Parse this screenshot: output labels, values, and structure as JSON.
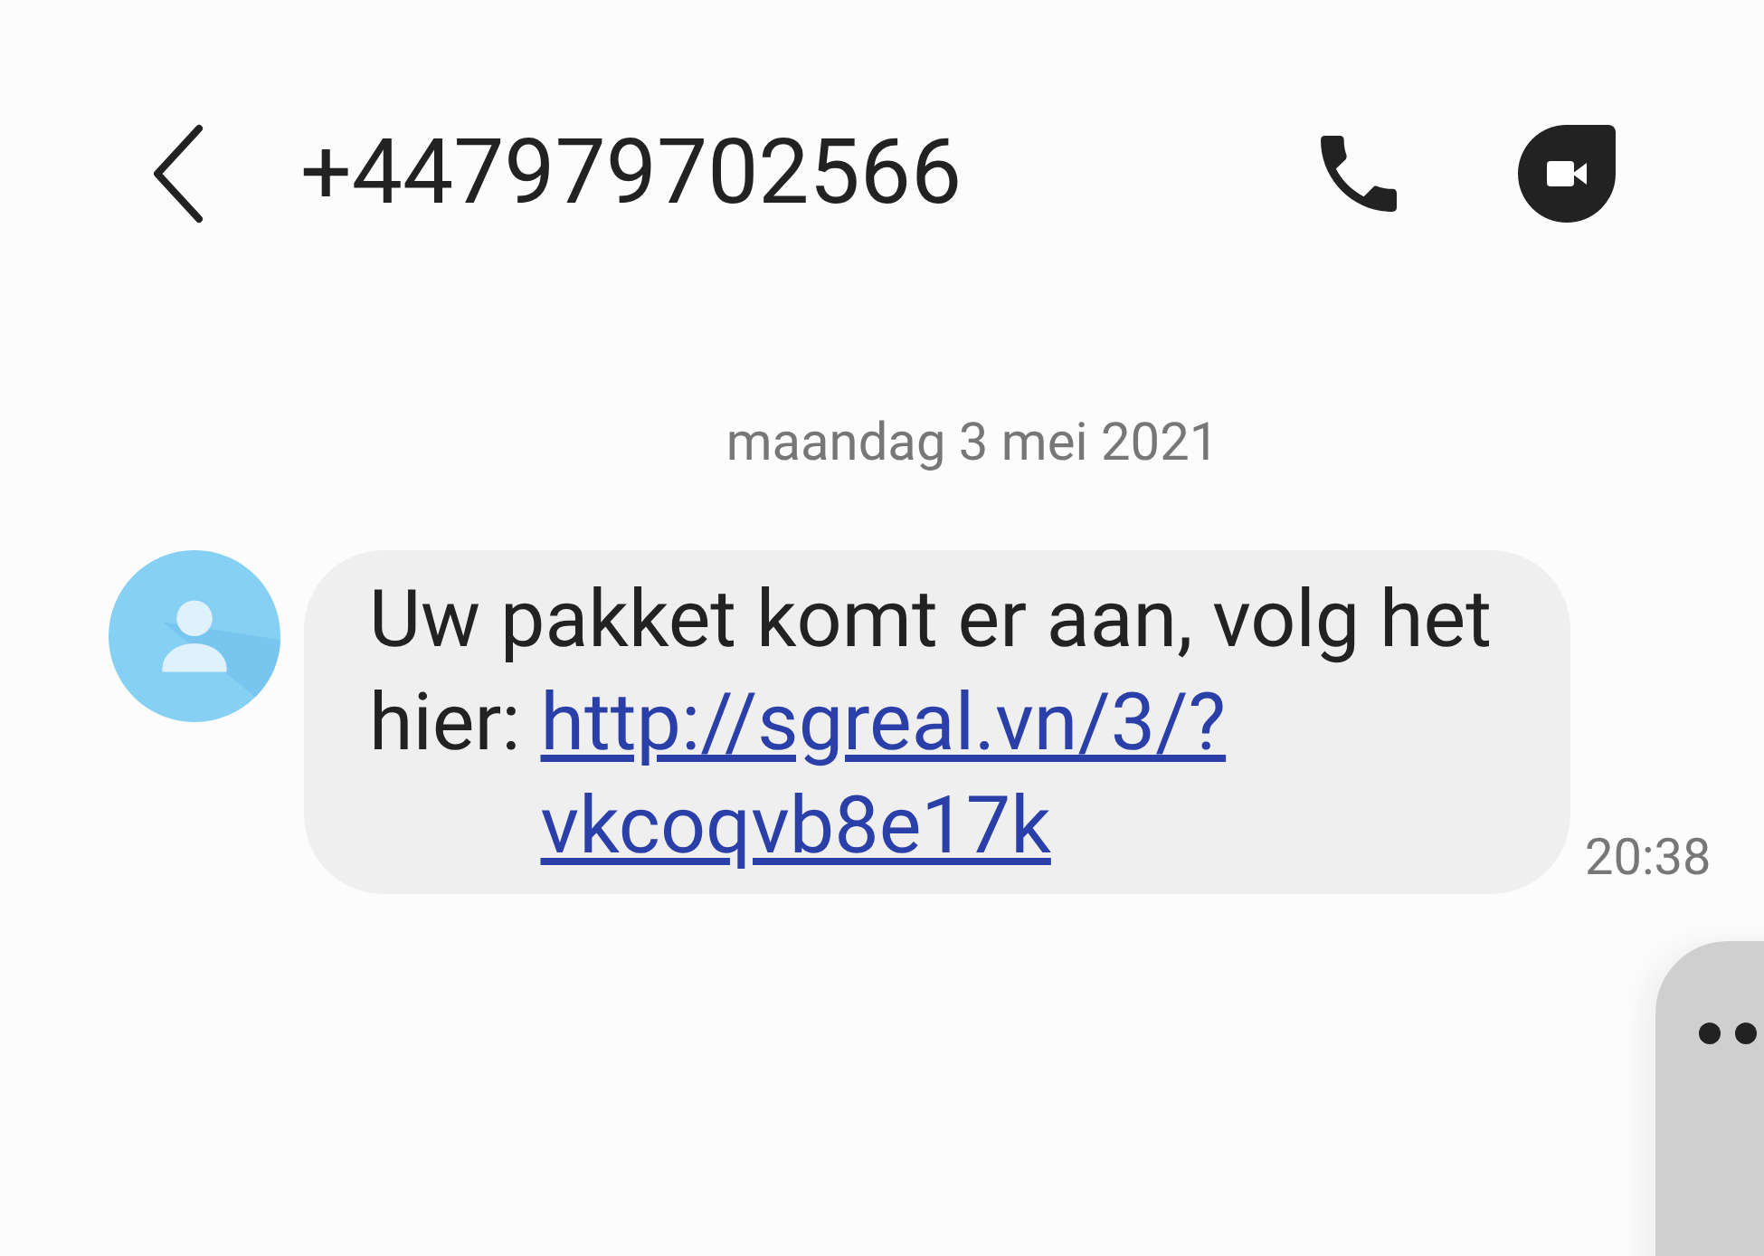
{
  "header": {
    "title": "+447979702566"
  },
  "date_divider": "maandag 3 mei 2021",
  "messages": [
    {
      "kind": "received",
      "text": "Uw pakket komt er aan, volg het hier: ",
      "link": "http://sgreal.vn/3/?vkcoqvb8e17k",
      "time": "20:38"
    }
  ]
}
